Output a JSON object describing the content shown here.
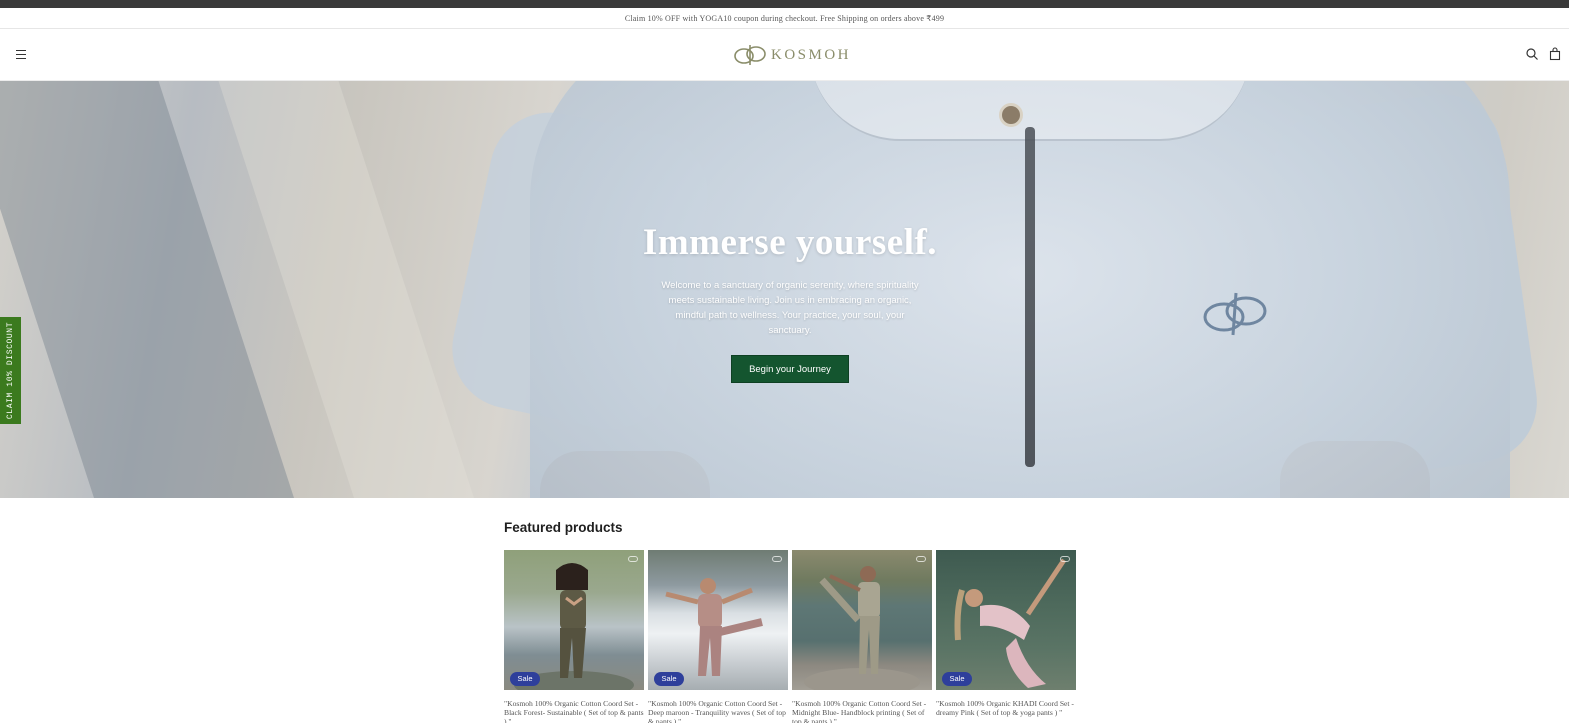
{
  "announcement": {
    "text": "Claim 10% OFF with YOGA10 coupon during checkout. Free Shipping on orders above ₹499"
  },
  "header": {
    "logo_text": "KOSMOH",
    "icons": [
      "menu-icon",
      "search-icon",
      "cart-icon"
    ]
  },
  "hero": {
    "title": "Immerse yourself.",
    "text": "Welcome to a sanctuary of organic serenity, where spirituality meets sustainable living. Join us in embracing an organic, mindful path to wellness. Your practice, your soul, your sanctuary.",
    "cta_label": "Begin your Journey"
  },
  "side_tab": {
    "label": "CLAIM 10% DISCOUNT"
  },
  "featured": {
    "title": "Featured products",
    "products": [
      {
        "title": "\"Kosmoh 100% Organic Cotton Coord Set - Black Forest- Sustainable ( Set of top & pants ) \"",
        "badge": "Sale"
      },
      {
        "title": "\"Kosmoh 100% Organic Cotton Coord Set - Deep maroon - Tranquility waves ( Set of top & pants ) \"",
        "badge": "Sale"
      },
      {
        "title": "\"Kosmoh 100% Organic Cotton Coord Set - Midnight Blue- Handblock printing ( Set of top & pants ) \"",
        "badge": ""
      },
      {
        "title": "\"Kosmoh 100% Organic KHADI Coord Set - dreamy Pink ( Set of top & yoga pants ) \"",
        "badge": "Sale"
      }
    ]
  },
  "colors": {
    "cta_green": "#14552f",
    "side_tab_green": "#3b7a1e",
    "sale_badge_blue": "#2e3f9b",
    "logo_olive": "#8a8d6a"
  }
}
